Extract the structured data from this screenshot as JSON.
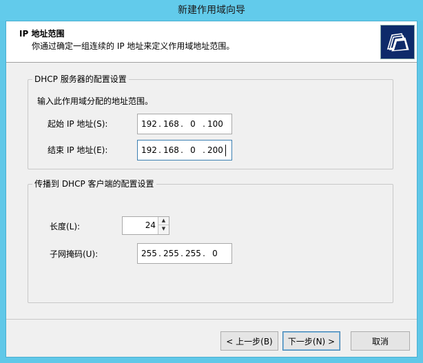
{
  "window": {
    "title": "新建作用域向导"
  },
  "header": {
    "title": "IP 地址范围",
    "subtitle": "你通过确定一组连续的 IP 地址来定义作用域地址范围。",
    "icon": "folders-icon"
  },
  "dhcp_group": {
    "legend": "DHCP 服务器的配置设置",
    "instruction": "输入此作用域分配的地址范围。",
    "start_label": "起始 IP 地址(S):",
    "start_ip": [
      "192",
      "168",
      "0",
      "100"
    ],
    "end_label": "结束 IP 地址(E):",
    "end_ip": [
      "192",
      "168",
      "0",
      "200"
    ]
  },
  "client_group": {
    "legend": "传播到 DHCP 客户端的配置设置",
    "length_label": "长度(L):",
    "length_value": "24",
    "mask_label": "子网掩码(U):",
    "mask": [
      "255",
      "255",
      "255",
      "0"
    ]
  },
  "buttons": {
    "back": "< 上一步(B)",
    "next": "下一步(N) >",
    "cancel": "取消"
  },
  "ip_separator": "."
}
